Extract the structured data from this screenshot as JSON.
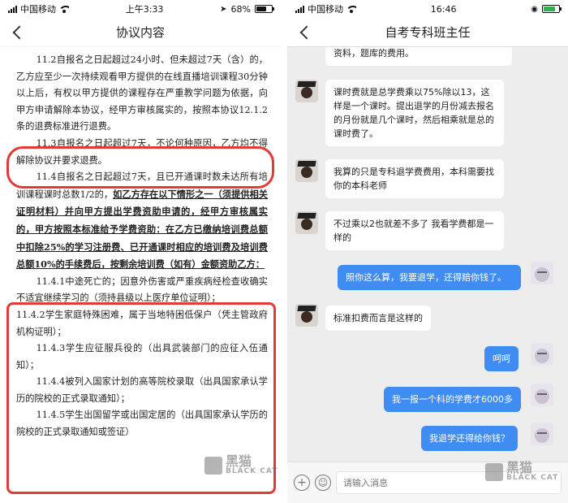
{
  "left": {
    "status": {
      "carrier": "中国移动",
      "time": "上午3:33",
      "battery": "68%"
    },
    "nav": {
      "title": "协议内容"
    },
    "doc": {
      "p1": "11.2自报名之日起超过24小时、但未超过7天（含）的，乙方应至少一次持续观看甲方提供的在线直播培训课程30分钟以上后，有权以甲方提供的课程存在严重教学问题为依据，向甲方申请解除本协议，经甲方审核属实的，按照本协议12.1.2条的退费标准进行退费。",
      "p2": "11.3自报名之日起超过7天，不论何种原因，乙方均不得解除协议并要求退费。",
      "p3_plain": "11.4自报名之日起超过7天，且已开通课时数未达所有培训课程课时总数1/2的，",
      "p3_bold": "如乙方存在以下情形之一（须提供相关证明材料）并向甲方提出学费资助申请的，经甲方审核属实的，甲方按照本标准给予学费资助：在乙方已缴纳培训费总额中扣除25%的学习注册费、已开通课时相应的培训费及培训费总额10%的手续费后，按剩余培训费（如有）金额资助乙方：",
      "i1": "11.4.1中途死亡的；因意外伤害或严重疾病经检查收确实不适宜继续学习的（须持县级以上医疗单位证明）；",
      "i2": "11.4.2学生家庭特殊困难，属于当地特困低保户（凭主管政府机构证明）；",
      "i3": "11.4.3学生应征服兵役的（出具武装部门的应征入伍通知）；",
      "i4": "11.4.4被列入国家计划的高等院校录取（出具国家承认学历的院校的正式录取通知）；",
      "i5": "11.4.5学生出国留学或出国定居的（出具国家承认学历的院校的正式录取通知或签证）"
    },
    "watermark": {
      "cn": "黑猫",
      "en": "BLACK CAT"
    }
  },
  "right": {
    "status": {
      "carrier": "中国移动",
      "time": "16:46"
    },
    "nav": {
      "title": "自考专科班主任"
    },
    "messages": [
      {
        "text": "资料，题库的费用。"
      },
      {
        "text": "课时费就是总学费乘以75%除以13，这样是一个课时。提出退学的月份减去报名的月份就是几个课时，然后相乘就是总的课时费了。"
      },
      {
        "text": "我算的只是专科退学费费用，本科需要找你的本科老师"
      },
      {
        "text": "不过乘以2也就差不多了 我看学费都是一样的"
      },
      {
        "text": "照你这么算，我要退学，还得赔你钱了。"
      },
      {
        "text": "标准扣费而言是这样的"
      },
      {
        "text": "呵呵"
      },
      {
        "text": "我一报一个科的学费才6000多"
      },
      {
        "text": "我退学还得给你钱？"
      }
    ],
    "input": {
      "placeholder": "请输入消息"
    },
    "watermark": {
      "cn": "黑猫",
      "en": "BLACK CAT"
    }
  },
  "colors": {
    "accent_bubble": "#3f8cf3",
    "annotation": "#e23a3a",
    "chat_bg": "#ededed"
  },
  "icons": [
    "back-chevron-icon",
    "signal-icon",
    "wifi-icon",
    "battery-icon",
    "plus-icon",
    "emoji-icon",
    "location-icon"
  ]
}
